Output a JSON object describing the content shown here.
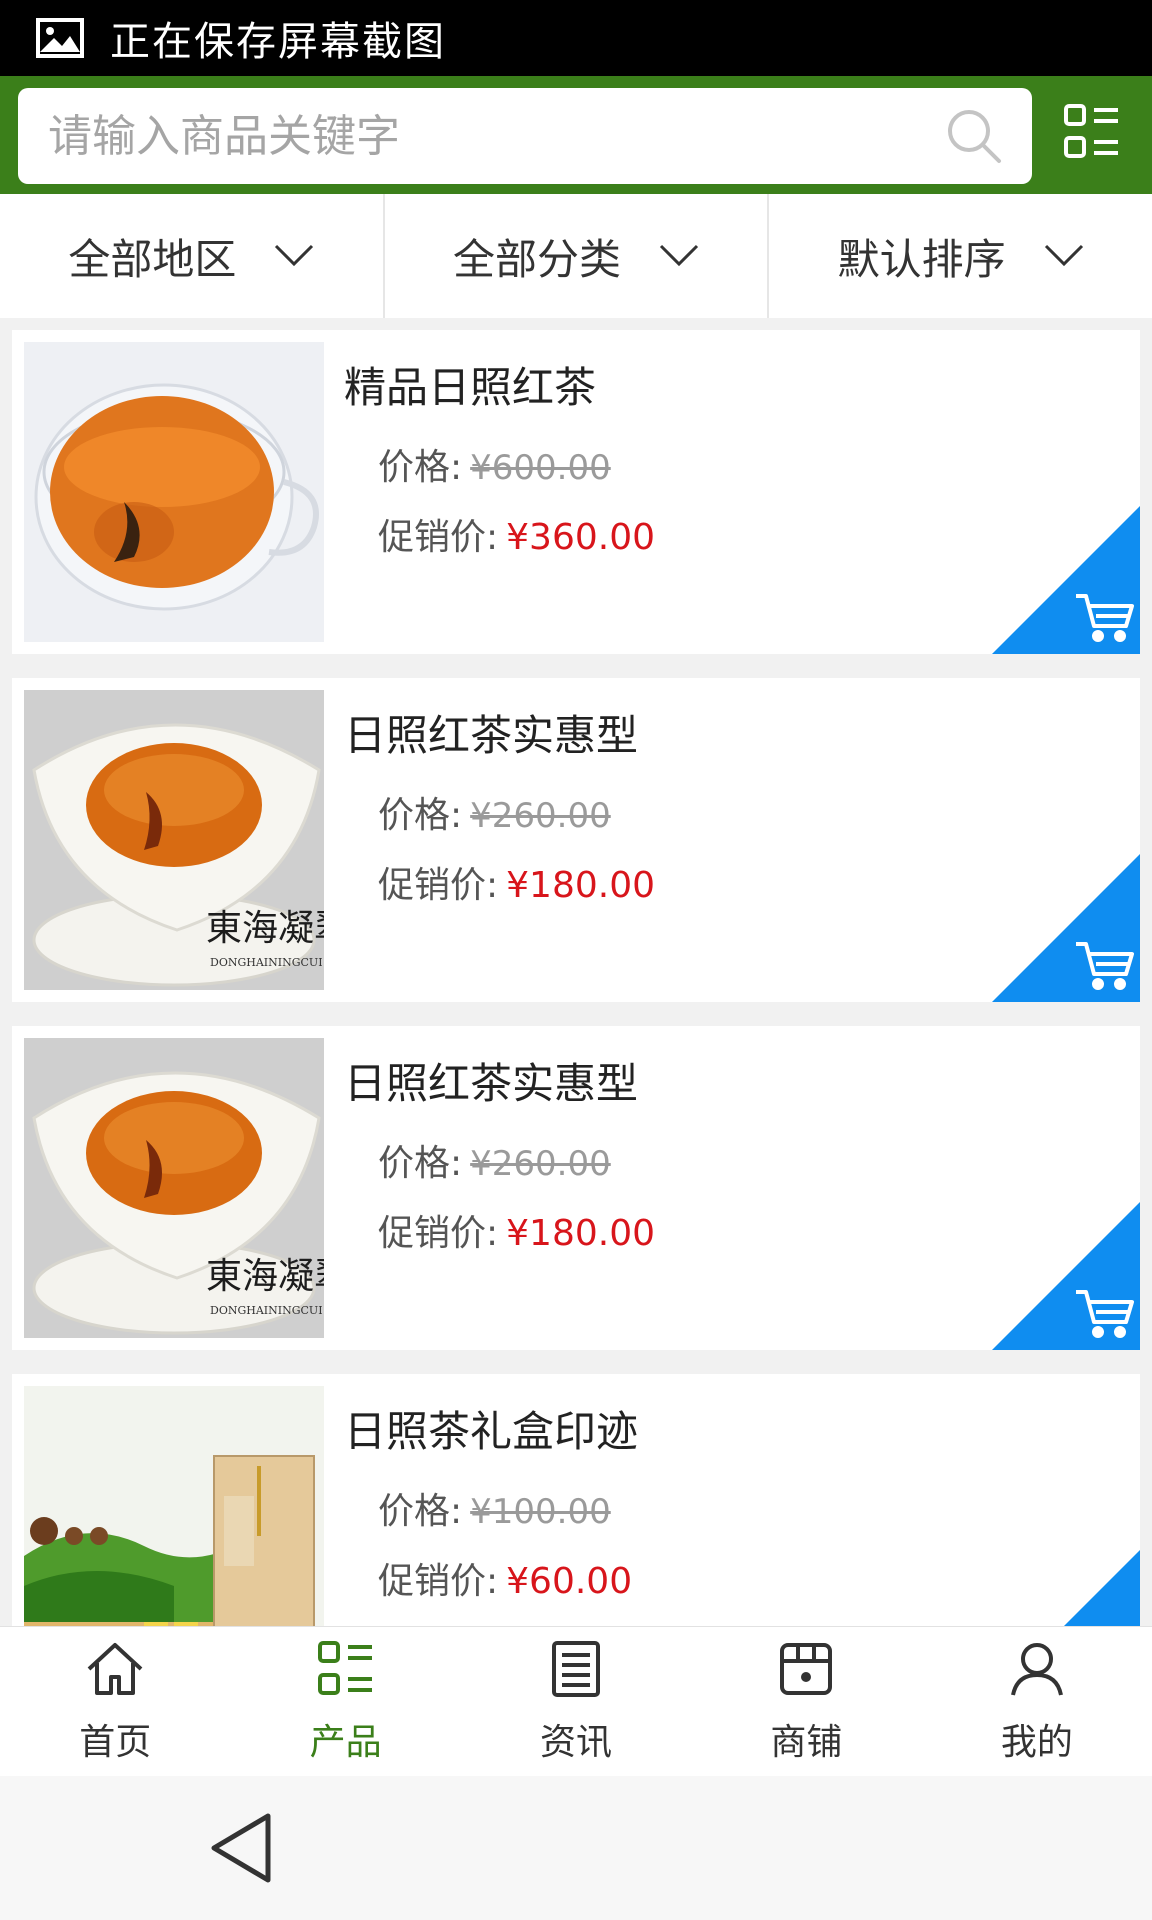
{
  "status_bar": {
    "text": "正在保存屏幕截图",
    "icon": "image-icon"
  },
  "search": {
    "placeholder": "请输入商品关键字",
    "icon": "search-icon",
    "menu_icon": "grid-list-icon"
  },
  "filters": [
    {
      "label": "全部地区"
    },
    {
      "label": "全部分类"
    },
    {
      "label": "默认排序"
    }
  ],
  "products": [
    {
      "title": "精品日照红茶",
      "price_label": "价格:",
      "price": "¥600.00",
      "promo_label": "促销价:",
      "promo_price": "¥360.00",
      "image": "glass-cup-red-tea"
    },
    {
      "title": "日照红茶实惠型",
      "price_label": "价格:",
      "price": "¥260.00",
      "promo_label": "促销价:",
      "promo_price": "¥180.00",
      "image": "white-gaiwan-tea"
    },
    {
      "title": "日照红茶实惠型",
      "price_label": "价格:",
      "price": "¥260.00",
      "promo_label": "促销价:",
      "promo_price": "¥180.00",
      "image": "white-gaiwan-tea"
    },
    {
      "title": "日照茶礼盒印迹",
      "price_label": "价格:",
      "price": "¥100.00",
      "promo_label": "促销价:",
      "promo_price": "¥60.00",
      "image": "tea-gift-box"
    }
  ],
  "brand_watermark": {
    "text": "東海凝翠",
    "subtext": "DONGHAININGCUI"
  },
  "tabbar": [
    {
      "label": "首页",
      "icon": "home-icon",
      "active": false
    },
    {
      "label": "产品",
      "icon": "product-list-icon",
      "active": true
    },
    {
      "label": "资讯",
      "icon": "news-icon",
      "active": false
    },
    {
      "label": "商铺",
      "icon": "shop-icon",
      "active": false
    },
    {
      "label": "我的",
      "icon": "user-icon",
      "active": false
    }
  ],
  "colors": {
    "header_green": "#3b7f1a",
    "accent_blue": "#0f8df0",
    "price_red": "#d8151b"
  }
}
